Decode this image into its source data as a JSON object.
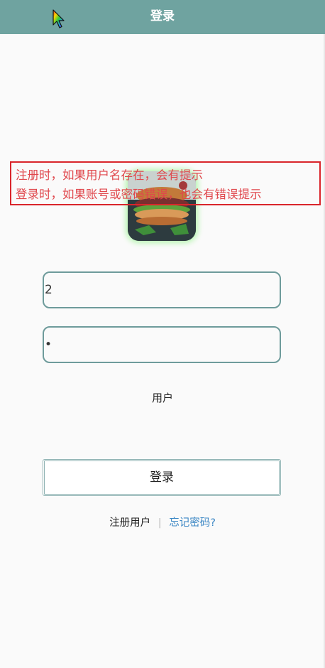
{
  "header": {
    "title": "登录"
  },
  "annotation": {
    "line1": "注册时，如果用户名存在，会有提示",
    "line2": "登录时，如果账号或密码错误，也会有错误提示"
  },
  "form": {
    "username_value": "2",
    "password_value": "•",
    "role_label": "用户",
    "login_label": "登录"
  },
  "links": {
    "register": "注册用户",
    "separator": "|",
    "forgot": "忘记密码?"
  },
  "colors": {
    "header_bg": "#6fa3a0",
    "annotation_red": "#d9252b",
    "input_border": "#6e9b9b",
    "link_blue": "#3a86c4"
  },
  "icons": {
    "cursor": "rainbow-arrow-cursor-icon"
  }
}
